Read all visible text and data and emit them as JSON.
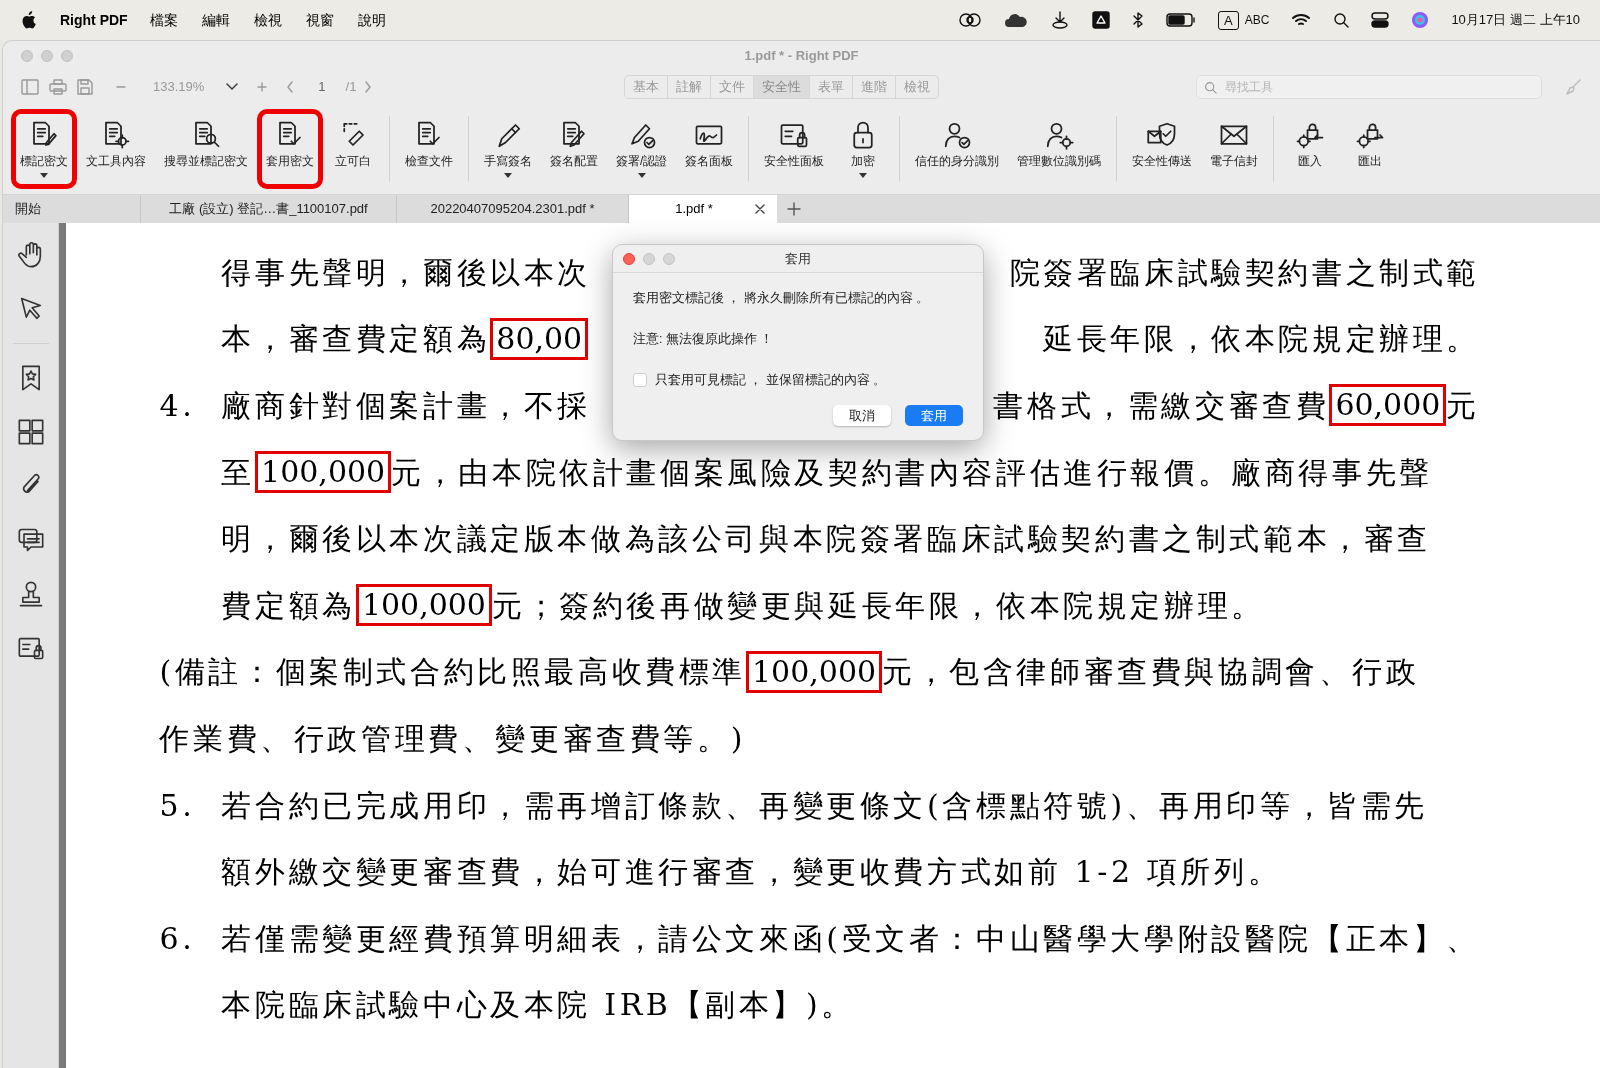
{
  "menu_bar": {
    "app_name": "Right PDF",
    "menus": [
      "檔案",
      "編輯",
      "檢視",
      "視窗",
      "說明"
    ],
    "input_badge": "A",
    "input_source": "ABC",
    "clock": "10月17日 週二 上午10"
  },
  "window": {
    "title": "1.pdf * - Right PDF"
  },
  "nav_bar": {
    "zoom": "133.19%",
    "page": "1",
    "page_count": "/1"
  },
  "mode_tabs": [
    {
      "label": "基本",
      "selected": false
    },
    {
      "label": "註解",
      "selected": false
    },
    {
      "label": "文件",
      "selected": false
    },
    {
      "label": "安全性",
      "selected": true
    },
    {
      "label": "表單",
      "selected": false
    },
    {
      "label": "進階",
      "selected": false
    },
    {
      "label": "檢視",
      "selected": false
    }
  ],
  "tool_search": {
    "placeholder": "尋找工具"
  },
  "toolbar_groups": [
    [
      {
        "label": "標記密文",
        "dropdown": true,
        "highlighted": true
      },
      {
        "label": "文工具內容",
        "dropdown": false,
        "highlighted": false
      },
      {
        "label": "搜尋並標記密文",
        "dropdown": false,
        "highlighted": false
      },
      {
        "label": "套用密文",
        "dropdown": false,
        "highlighted": true
      },
      {
        "label": "立可白",
        "dropdown": false,
        "highlighted": false
      }
    ],
    [
      {
        "label": "檢查文件",
        "dropdown": false,
        "highlighted": false
      }
    ],
    [
      {
        "label": "手寫簽名",
        "dropdown": true,
        "highlighted": false
      },
      {
        "label": "簽名配置",
        "dropdown": false,
        "highlighted": false
      },
      {
        "label": "簽署/認證",
        "dropdown": true,
        "highlighted": false
      },
      {
        "label": "簽名面板",
        "dropdown": false,
        "highlighted": false
      }
    ],
    [
      {
        "label": "安全性面板",
        "dropdown": false,
        "highlighted": false
      },
      {
        "label": "加密",
        "dropdown": true,
        "highlighted": false
      }
    ],
    [
      {
        "label": "信任的身分識別",
        "dropdown": false,
        "highlighted": false
      },
      {
        "label": "管理數位識別碼",
        "dropdown": false,
        "highlighted": false
      }
    ],
    [
      {
        "label": "安全性傳送",
        "dropdown": false,
        "highlighted": false
      },
      {
        "label": "電子信封",
        "dropdown": false,
        "highlighted": false
      }
    ],
    [
      {
        "label": "匯入",
        "dropdown": false,
        "highlighted": false
      },
      {
        "label": "匯出",
        "dropdown": false,
        "highlighted": false
      }
    ]
  ],
  "doc_tabs": [
    {
      "label": "開始",
      "selected": false,
      "closable": false
    },
    {
      "label": "工廠 (設立) 登記…書_1100107.pdf",
      "selected": false,
      "closable": false
    },
    {
      "label": "20220407095204.2301.pdf *",
      "selected": false,
      "closable": false
    },
    {
      "label": "1.pdf *",
      "selected": true,
      "closable": true
    }
  ],
  "document": {
    "lines": [
      {
        "indent": true,
        "left": [
          {
            "text": "得事先聲明，爾後以本次",
            "boxed": false
          }
        ],
        "right": [
          {
            "text": "院簽署臨床試驗契約書之制式範",
            "boxed": false
          }
        ]
      },
      {
        "indent": true,
        "left": [
          {
            "text": "本，審查費定額為",
            "boxed": false
          },
          {
            "text": "80,00",
            "boxed": true
          }
        ],
        "right": [
          {
            "text": "延長年限，依本院規定辦理。",
            "boxed": false
          }
        ]
      },
      {
        "number": "4.",
        "left": [
          {
            "text": "廠商針對個案計畫，不採",
            "boxed": false
          }
        ],
        "right": [
          {
            "text": "書格式，需繳交審查費",
            "boxed": false
          },
          {
            "text": "60,000",
            "boxed": true
          },
          {
            "text": "元",
            "boxed": false
          }
        ]
      },
      {
        "indent": true,
        "left": [
          {
            "text": "至",
            "boxed": false
          },
          {
            "text": "100,000",
            "boxed": true
          },
          {
            "text": "元，由本院依計畫個案風險及契約書內容評估進行報價。廠商得事先聲",
            "boxed": false
          }
        ]
      },
      {
        "indent": true,
        "left": [
          {
            "text": "明，爾後以本次議定版本做為該公司與本院簽署臨床試驗契約書之制式範本，審查",
            "boxed": false
          }
        ]
      },
      {
        "indent": true,
        "left": [
          {
            "text": "費定額為",
            "boxed": false
          },
          {
            "text": "100,000",
            "boxed": true
          },
          {
            "text": "元；簽約後再做變更與延長年限，依本院規定辦理。",
            "boxed": false
          }
        ]
      },
      {
        "indent": false,
        "left": [
          {
            "text": "(備註：個案制式合約比照最高收費標準",
            "boxed": false
          },
          {
            "text": "100,000",
            "boxed": true
          },
          {
            "text": "元，包含律師審查費與協調會、行政",
            "boxed": false
          }
        ]
      },
      {
        "indent": false,
        "left": [
          {
            "text": "作業費、行政管理費、變更審查費等。)",
            "boxed": false
          }
        ]
      },
      {
        "number": "5.",
        "left": [
          {
            "text": "若合約已完成用印，需再增訂條款、再變更條文(含標點符號)、再用印等，皆需先",
            "boxed": false
          }
        ]
      },
      {
        "indent": true,
        "left": [
          {
            "text": "額外繳交變更審查費，始可進行審查，變更收費方式如前 1-2 項所列。",
            "boxed": false
          }
        ]
      },
      {
        "number": "6.",
        "left": [
          {
            "text": "若僅需變更經費預算明細表，請公文來函(受文者：中山醫學大學附設醫院【正本】、",
            "boxed": false
          }
        ]
      },
      {
        "indent": true,
        "left": [
          {
            "text": "本院臨床試驗中心及本院 IRB【副本】)。",
            "boxed": false
          }
        ]
      }
    ]
  },
  "dialog": {
    "title": "套用",
    "message": "套用密文標記後 ， 將永久刪除所有已標記的內容 。",
    "note": "注意: 無法復原此操作 ！",
    "checkbox": {
      "label": "只套用可見標記 ， 並保留標記的內容 。",
      "checked": false
    },
    "buttons": [
      {
        "label": "取消",
        "primary": false
      },
      {
        "label": "套用",
        "primary": true
      }
    ]
  }
}
